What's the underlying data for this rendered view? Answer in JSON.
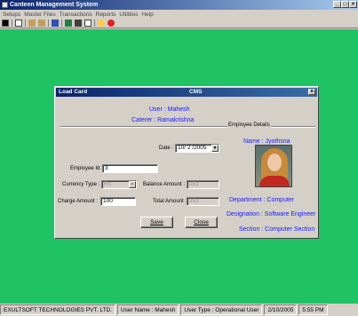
{
  "app": {
    "title": "Canteen Management System"
  },
  "menu": [
    "Setups",
    "Master Files",
    "Transactions",
    "Reports",
    "Utilities",
    "Help"
  ],
  "toolbar_icons": [
    "exit-icon",
    "tree-icon",
    "edit-icon",
    "check-icon",
    "monitor-icon",
    "book-icon",
    "card-icon",
    "disk-icon",
    "help-icon",
    "stop-icon"
  ],
  "dialog": {
    "title": "Load Card",
    "center_title": "CMS",
    "close": "x",
    "user": "User : Mahesh",
    "caterer": "Caterer : Ramakrishna",
    "group_label": "Employee Details",
    "date_label": "Date :",
    "date_value": "10/ 2 /2005",
    "employee_id_label": "Employee Id :",
    "employee_id_value": "3",
    "currency_label": "Currency Type :",
    "currency_value": "Rs",
    "balance_label": "Balance Amount :",
    "balance_value": "151",
    "charge_label": "Charge Amount :",
    "charge_value": "100",
    "total_label": "Total Amount :",
    "total_value": "251",
    "save_label": "Save",
    "close_label": "Close",
    "name": "Name : Jyothsna",
    "department": "Department : Computer",
    "designation": "Designation : Software Engineer",
    "section": "Section : Computer Section"
  },
  "status": {
    "company": "EXULTSOFT TECHNOLOGIES PVT. LTD.",
    "user_name": "User Name :  Mahesh",
    "user_type": "User Type :  Operational User",
    "date": "2/10/2005",
    "time": "5:55 PM"
  },
  "colors": {
    "workspace": "#20c364",
    "accent_blue": "#1a1aff",
    "titlebar": "#0a246a"
  }
}
